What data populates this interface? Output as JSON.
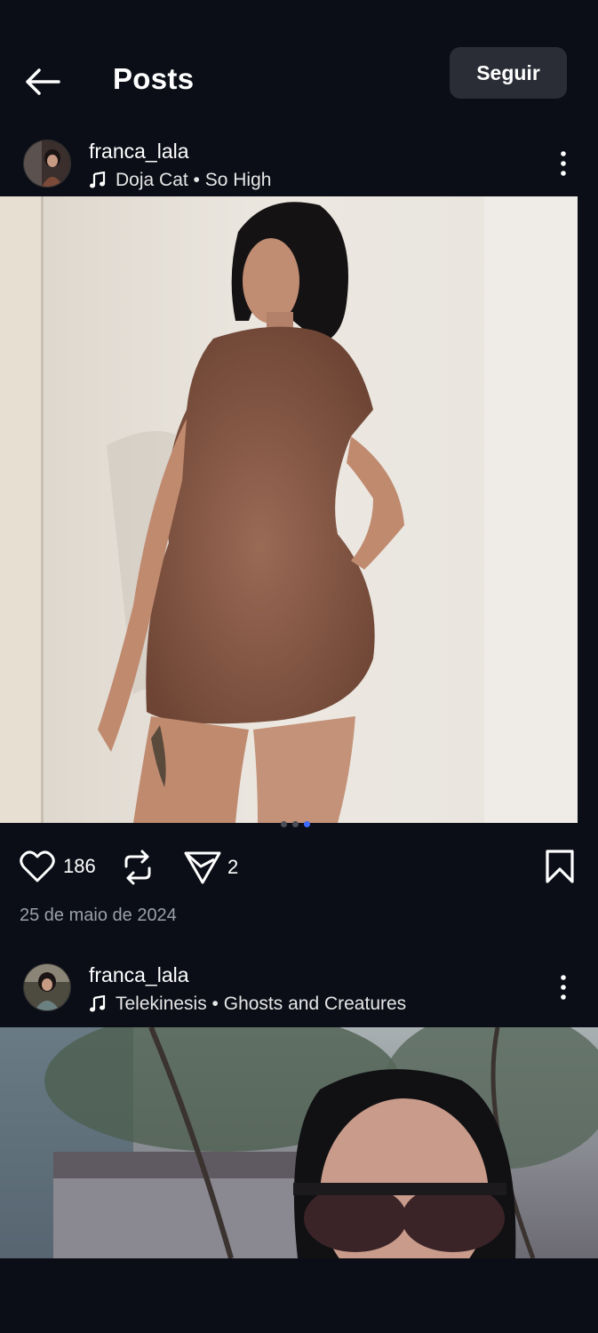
{
  "header": {
    "title": "Posts",
    "follow_label": "Seguir"
  },
  "posts": [
    {
      "username": "franca_lala",
      "music": "Doja Cat • So High",
      "likes": "186",
      "comments": "2",
      "date": "25 de maio de 2024",
      "carousel_count": 3,
      "carousel_active": 2
    },
    {
      "username": "franca_lala",
      "music": "Telekinesis • Ghosts and Creatures"
    }
  ],
  "colors": {
    "background": "#0b0e17",
    "button": "#2a2d35",
    "accent": "#3d6bff",
    "muted": "#9aa0aa"
  },
  "icons": [
    "back-arrow-icon",
    "music-note-icon",
    "more-vertical-icon",
    "heart-icon",
    "repost-icon",
    "send-icon",
    "bookmark-icon"
  ]
}
